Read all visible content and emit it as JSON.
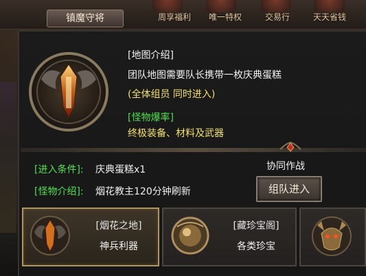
{
  "top": {
    "title": "镇魔守将",
    "nav": [
      {
        "label": "周享福利"
      },
      {
        "label": "唯一特权"
      },
      {
        "label": "交易行"
      },
      {
        "label": "天天省钱"
      }
    ]
  },
  "map": {
    "heading": "[地图介绍]",
    "desc": "团队地图需要队长携带一枚庆典蛋糕",
    "note": "(全体组员 同时进入)",
    "drop_heading": "[怪物爆率]",
    "drop_desc": "终极装备、材料及武器"
  },
  "conditions": {
    "entry_label": "[进入条件]:",
    "entry_value": "庆典蛋糕x1",
    "monster_label": "[怪物介绍]:",
    "monster_value": "烟花教主120分钟刷新"
  },
  "coop": {
    "title": "协同作战",
    "button": "组队进入"
  },
  "cards": [
    {
      "name": "[烟花之地]",
      "sub": "神兵利器"
    },
    {
      "name": "[藏珍宝阁]",
      "sub": "各类珍宝"
    }
  ]
}
